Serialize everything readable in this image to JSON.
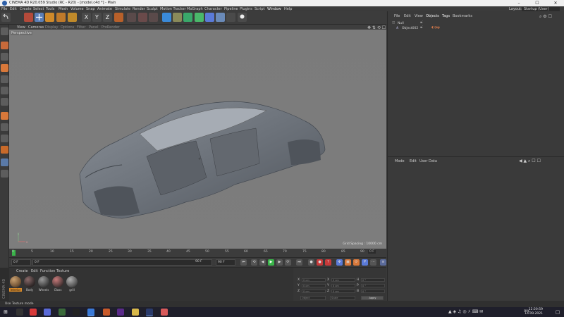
{
  "window": {
    "title": "CINEMA 4D R20.059 Studio (RC - R20) - [model.c4d *] - Main",
    "controls": [
      "–",
      "☐",
      "✕"
    ]
  },
  "menu": [
    "File",
    "Edit",
    "Create",
    "Select",
    "Tools",
    "Mesh",
    "Volume",
    "Snap",
    "Animate",
    "Simulate",
    "Render",
    "Sculpt",
    "Motion Tracker",
    "MoGraph",
    "Character",
    "Pipeline",
    "Plugins",
    "Script",
    "Window",
    "Help"
  ],
  "layout": {
    "label": "Layout:",
    "value": "Startup (User)"
  },
  "viewport": {
    "menu": [
      "View",
      "Cameras",
      "Display",
      "Options",
      "Filter",
      "Panel",
      "ProRender"
    ],
    "label": "Perspective",
    "grid_spacing": "Grid Spacing : 10000 cm",
    "axis_labels": [
      "y",
      "x"
    ]
  },
  "timeline": {
    "ticks": [
      "0",
      "5",
      "10",
      "15",
      "20",
      "25",
      "30",
      "35",
      "40",
      "45",
      "50",
      "55",
      "60",
      "65",
      "70",
      "75",
      "80",
      "85",
      "90"
    ],
    "current_frame": "0 F"
  },
  "transport": {
    "start": "0 F",
    "range_start": "0 F",
    "range_end": "90 F",
    "end": "90 F"
  },
  "materials": {
    "menu": [
      "Create",
      "Edit",
      "Function",
      "Texture"
    ],
    "items": [
      {
        "label": "Interior",
        "color": "#7a5a3a"
      },
      {
        "label": "Body",
        "color": "#3a3030"
      },
      {
        "label": "Wheels",
        "color": "#4a4a4a"
      },
      {
        "label": "Glass",
        "color": "#5a4040"
      },
      {
        "label": "grill",
        "color": "#5c5c5c"
      }
    ]
  },
  "coordinates": {
    "rows": [
      {
        "axis": "X",
        "pos": "0 cm",
        "axis2": "X",
        "size": "0 cm",
        "axis3": "H",
        "rot": "0 °"
      },
      {
        "axis": "Y",
        "pos": "0 cm",
        "axis2": "Y",
        "size": "0 cm",
        "axis3": "P",
        "rot": "0 °"
      },
      {
        "axis": "Z",
        "pos": "0 cm",
        "axis2": "Z",
        "size": "0 cm",
        "axis3": "B",
        "rot": "0 °"
      }
    ],
    "mode1": "Object",
    "mode2": "Scale",
    "apply": "Apply"
  },
  "c4d_vertical_label": "CINEMA 4D",
  "status": "Use Texture mode",
  "objects_panel": {
    "menu": [
      "File",
      "Edit",
      "View",
      "Objects",
      "Tags",
      "Bookmarks"
    ],
    "rows": [
      {
        "name": "Null"
      },
      {
        "name": "Object002"
      }
    ]
  },
  "attributes_panel": {
    "menu": [
      "Mode",
      "Edit",
      "User Data"
    ]
  },
  "taskbar": {
    "language": "РУС",
    "time": "12:20:59",
    "date": "14.09.2021"
  },
  "colors": {
    "accent_orange": "#d88a2a",
    "viewport_bg": "#7c7c7c",
    "play_green": "#3ab54a"
  }
}
